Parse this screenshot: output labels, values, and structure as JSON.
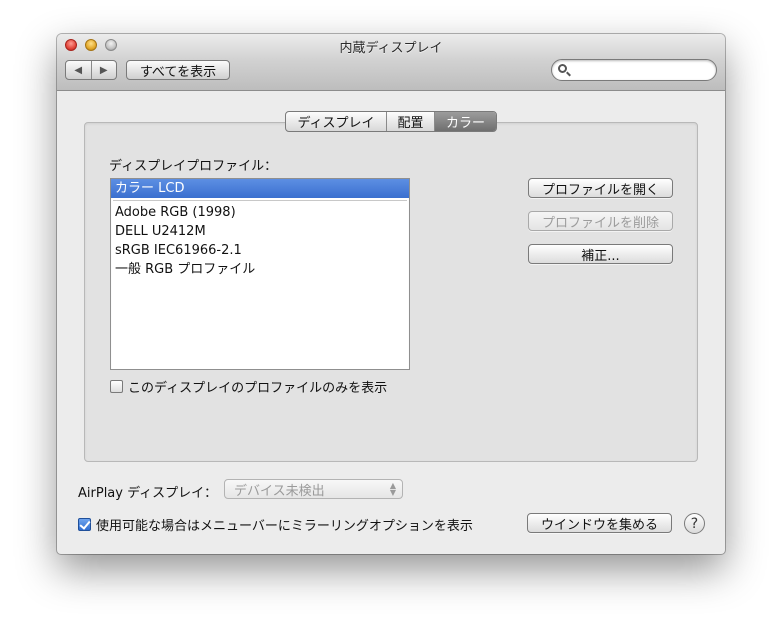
{
  "window": {
    "title": "内蔵ディスプレイ"
  },
  "toolbar": {
    "back_glyph": "◀",
    "forward_glyph": "▶",
    "show_all_label": "すべてを表示",
    "search_value": "",
    "search_placeholder": ""
  },
  "tabs": [
    {
      "label": "ディスプレイ",
      "active": false
    },
    {
      "label": "配置",
      "active": false
    },
    {
      "label": "カラー",
      "active": true
    }
  ],
  "color_panel": {
    "profile_label": "ディスプレイプロファイル：",
    "profiles": [
      {
        "label": "カラー LCD",
        "selected": true
      },
      {
        "label": "Adobe RGB (1998)",
        "selected": false
      },
      {
        "label": "DELL U2412M",
        "selected": false
      },
      {
        "label": "sRGB IEC61966-2.1",
        "selected": false
      },
      {
        "label": "一般 RGB プロファイル",
        "selected": false
      }
    ],
    "open_profile_label": "プロファイルを開く",
    "delete_profile_label": "プロファイルを削除",
    "calibrate_label": "補正...",
    "only_this_display_label": "このディスプレイのプロファイルのみを表示",
    "only_this_display_checked": false
  },
  "airplay": {
    "label": "AirPlay ディスプレイ：",
    "selected_value": "デバイス未検出",
    "select_arrows": "▲▼"
  },
  "mirroring": {
    "label": "使用可能な場合はメニューバーにミラーリングオプションを表示",
    "checked": true
  },
  "gather_windows_label": "ウインドウを集める",
  "help_glyph": "?",
  "colors": {
    "selection": "#3a6fcf",
    "checkbox_checked": "#2f6ed0"
  }
}
